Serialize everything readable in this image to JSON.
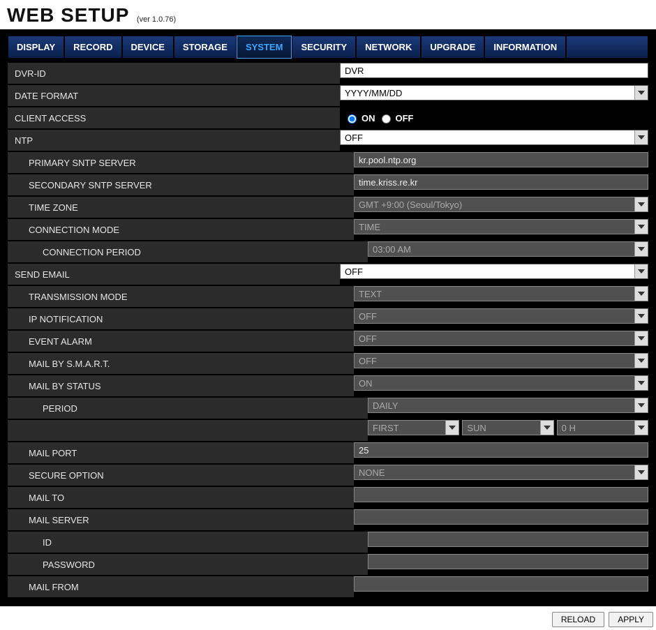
{
  "header": {
    "title": "WEB SETUP",
    "version": "(ver 1.0.76)"
  },
  "tabs": [
    "DISPLAY",
    "RECORD",
    "DEVICE",
    "STORAGE",
    "SYSTEM",
    "SECURITY",
    "NETWORK",
    "UPGRADE",
    "INFORMATION"
  ],
  "active_tab": "SYSTEM",
  "fields": {
    "dvr_id": {
      "label": "DVR-ID",
      "value": "DVR"
    },
    "date_format": {
      "label": "DATE FORMAT",
      "value": "YYYY/MM/DD"
    },
    "client_access": {
      "label": "CLIENT ACCESS",
      "on": "ON",
      "off": "OFF",
      "value": "ON"
    },
    "ntp": {
      "label": "NTP",
      "value": "OFF"
    },
    "primary_sntp": {
      "label": "PRIMARY SNTP SERVER",
      "value": "kr.pool.ntp.org"
    },
    "secondary_sntp": {
      "label": "SECONDARY SNTP SERVER",
      "value": "time.kriss.re.kr"
    },
    "time_zone": {
      "label": "TIME ZONE",
      "value": "GMT +9:00 (Seoul/Tokyo)"
    },
    "connection_mode": {
      "label": "CONNECTION MODE",
      "value": "TIME"
    },
    "connection_period": {
      "label": "CONNECTION PERIOD",
      "value": "03:00 AM"
    },
    "send_email": {
      "label": "SEND EMAIL",
      "value": "OFF"
    },
    "transmission_mode": {
      "label": "TRANSMISSION MODE",
      "value": "TEXT"
    },
    "ip_notification": {
      "label": "IP NOTIFICATION",
      "value": "OFF"
    },
    "event_alarm": {
      "label": "EVENT ALARM",
      "value": "OFF"
    },
    "mail_smart": {
      "label": "MAIL BY S.M.A.R.T.",
      "value": "OFF"
    },
    "mail_status": {
      "label": "MAIL BY STATUS",
      "value": "ON"
    },
    "period": {
      "label": "PERIOD",
      "value": "DAILY"
    },
    "period_triple": {
      "a": "FIRST",
      "b": "SUN",
      "c": "0 H"
    },
    "mail_port": {
      "label": "MAIL PORT",
      "value": "25"
    },
    "secure_option": {
      "label": "SECURE OPTION",
      "value": "NONE"
    },
    "mail_to": {
      "label": "MAIL TO",
      "value": ""
    },
    "mail_server": {
      "label": "MAIL SERVER",
      "value": ""
    },
    "id": {
      "label": "ID",
      "value": ""
    },
    "password": {
      "label": "PASSWORD",
      "value": ""
    },
    "mail_from": {
      "label": "MAIL FROM",
      "value": ""
    }
  },
  "footer": {
    "reload": "RELOAD",
    "apply": "APPLY"
  }
}
